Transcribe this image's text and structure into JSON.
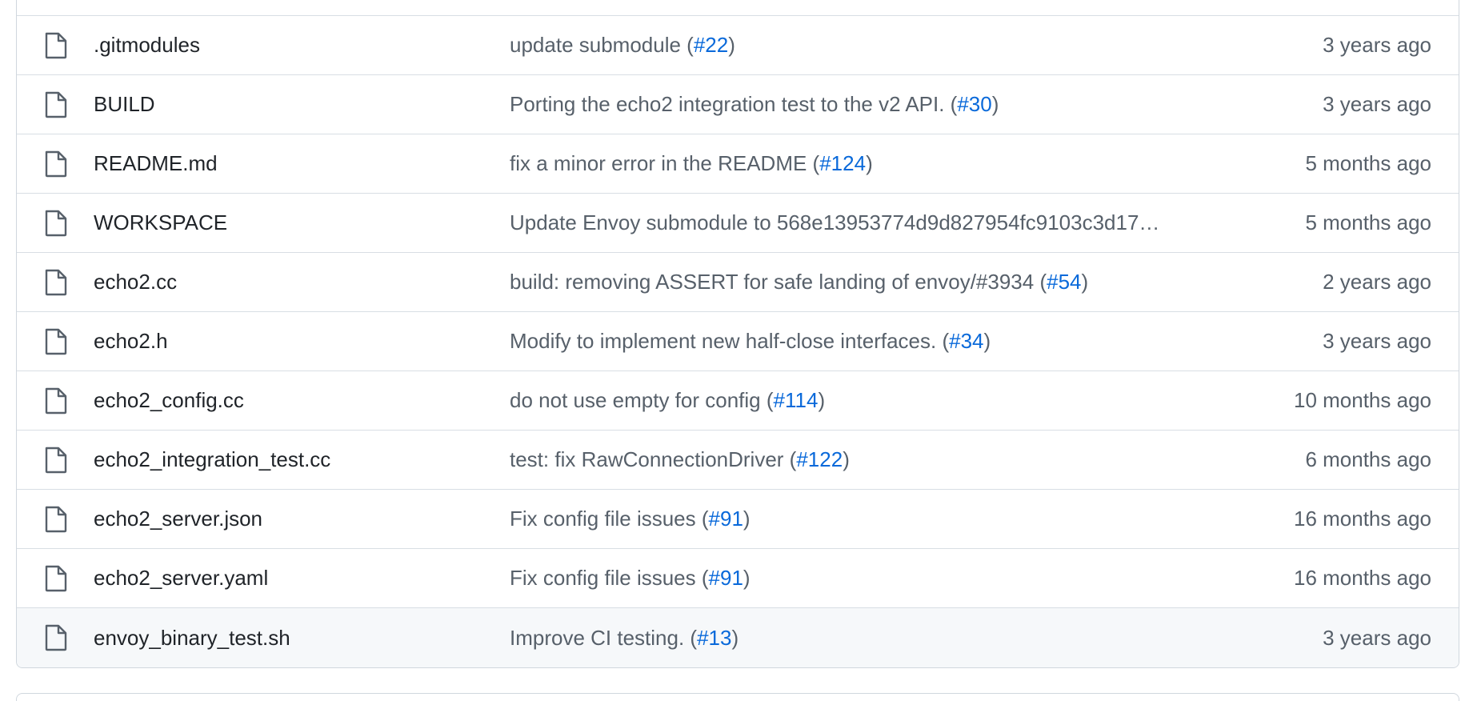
{
  "files": [
    {
      "name": ".gitmodules",
      "icon": "file-icon",
      "commit_text": "update submodule (",
      "issue": "#22",
      "commit_suffix": ")",
      "age": "3 years ago"
    },
    {
      "name": "BUILD",
      "icon": "file-icon",
      "commit_text": "Porting the echo2 integration test to the v2 API. (",
      "issue": "#30",
      "commit_suffix": ")",
      "age": "3 years ago"
    },
    {
      "name": "README.md",
      "icon": "file-icon",
      "commit_text": "fix a minor error in the README (",
      "issue": "#124",
      "commit_suffix": ")",
      "age": "5 months ago"
    },
    {
      "name": "WORKSPACE",
      "icon": "file-icon",
      "commit_text": "Update Envoy submodule to 568e13953774d9d827954fc9103c3d17…",
      "issue": "",
      "commit_suffix": "",
      "age": "5 months ago"
    },
    {
      "name": "echo2.cc",
      "icon": "file-icon",
      "commit_text": "build: removing ASSERT for safe landing of envoy/#3934 (",
      "issue": "#54",
      "commit_suffix": ")",
      "age": "2 years ago"
    },
    {
      "name": "echo2.h",
      "icon": "file-icon",
      "commit_text": "Modify to implement new half-close interfaces. (",
      "issue": "#34",
      "commit_suffix": ")",
      "age": "3 years ago"
    },
    {
      "name": "echo2_config.cc",
      "icon": "file-icon",
      "commit_text": "do not use empty for config (",
      "issue": "#114",
      "commit_suffix": ")",
      "age": "10 months ago"
    },
    {
      "name": "echo2_integration_test.cc",
      "icon": "file-icon",
      "commit_text": "test: fix RawConnectionDriver (",
      "issue": "#122",
      "commit_suffix": ")",
      "age": "6 months ago"
    },
    {
      "name": "echo2_server.json",
      "icon": "file-icon",
      "commit_text": "Fix config file issues (",
      "issue": "#91",
      "commit_suffix": ")",
      "age": "16 months ago"
    },
    {
      "name": "echo2_server.yaml",
      "icon": "file-icon",
      "commit_text": "Fix config file issues (",
      "issue": "#91",
      "commit_suffix": ")",
      "age": "16 months ago"
    },
    {
      "name": "envoy_binary_test.sh",
      "icon": "file-icon",
      "commit_text": "Improve CI testing. (",
      "issue": "#13",
      "commit_suffix": ")",
      "age": "3 years ago"
    }
  ],
  "colors": {
    "link": "#0969da",
    "text": "#1f2328",
    "muted": "#57606a",
    "border": "#d0d7de",
    "hover_row": "#f6f8fa"
  }
}
